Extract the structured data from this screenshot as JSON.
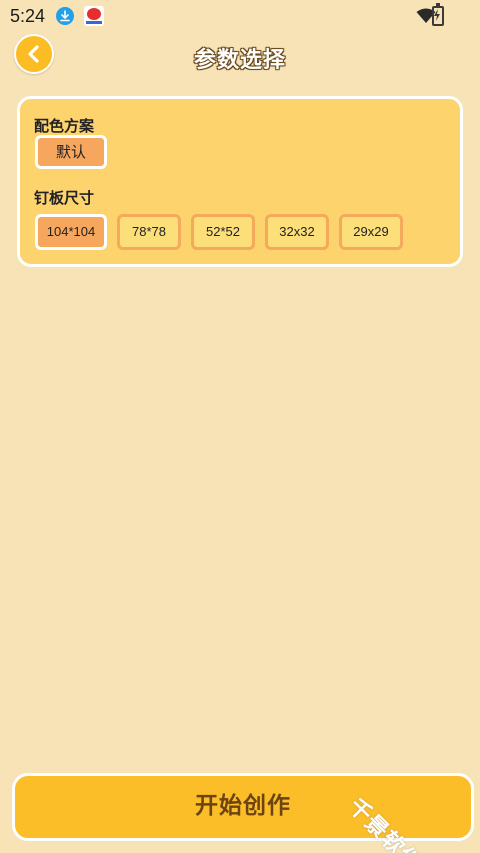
{
  "status_bar": {
    "time": "5:24",
    "icons": [
      "download-icon",
      "app-notification-icon",
      "wifi-icon",
      "battery-charging-icon"
    ]
  },
  "header": {
    "title": "参数选择",
    "back_icon": "chevron-left-icon"
  },
  "settings": {
    "color_scheme": {
      "label": "配色方案",
      "options": [
        "默认"
      ],
      "selected": "默认"
    },
    "board_size": {
      "label": "钉板尺寸",
      "options": [
        "104*104",
        "78*78",
        "52*52",
        "32x32",
        "29x29"
      ],
      "selected": "104*104"
    }
  },
  "start_button": {
    "label": "开始创作"
  },
  "watermark": "千景软件站",
  "colors": {
    "background": "#f7e3b6",
    "card": "#fcd36d",
    "accent": "#fbbd28",
    "selected_option": "#f7a75d",
    "option_border": "#f5a95a"
  }
}
